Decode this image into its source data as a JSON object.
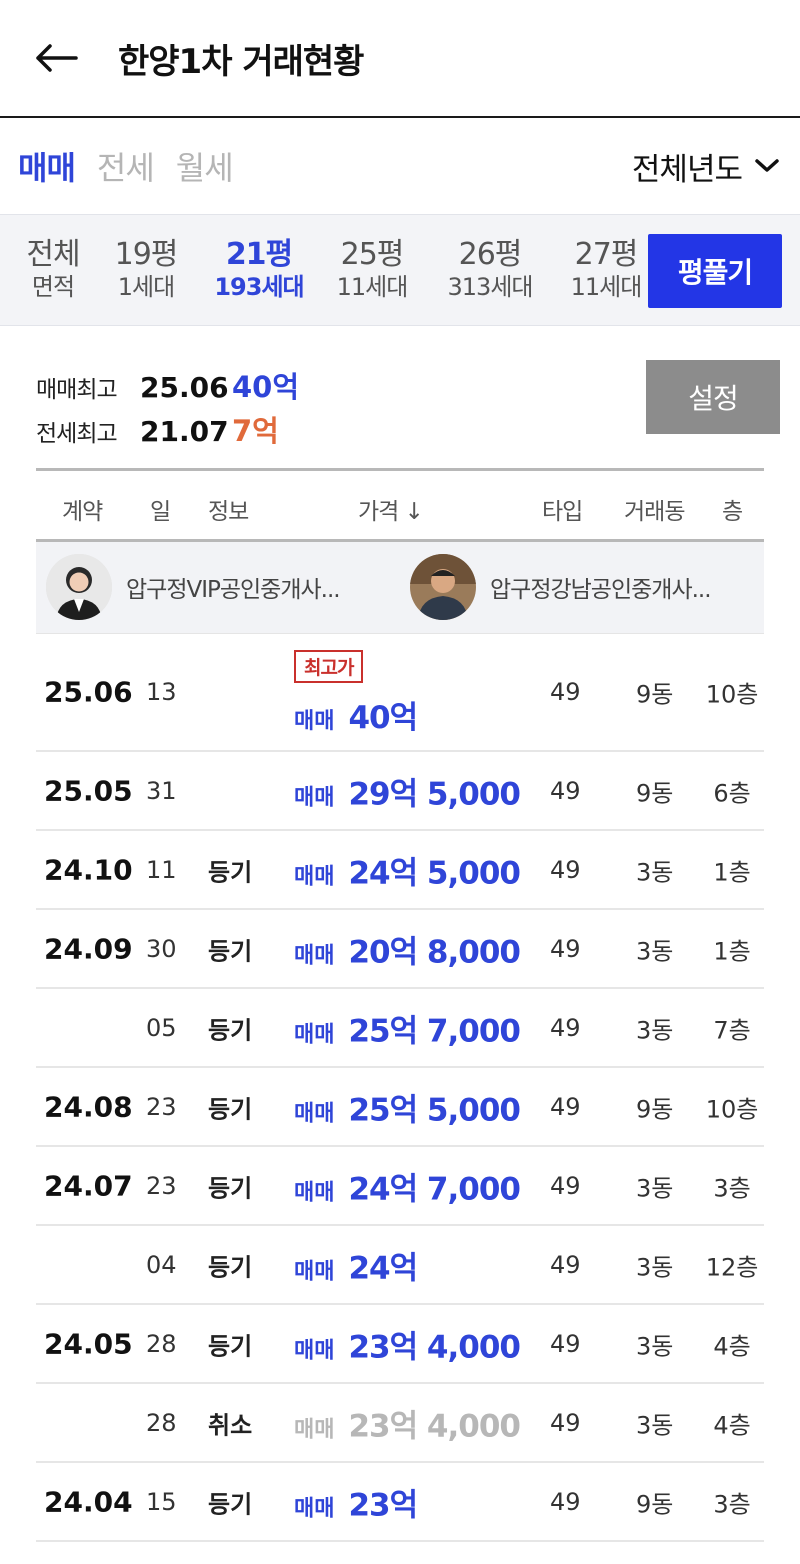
{
  "header": {
    "title": "한양1차 거래현황"
  },
  "deal_tabs": [
    {
      "label": "매매",
      "active": true
    },
    {
      "label": "전세",
      "active": false
    },
    {
      "label": "월세",
      "active": false
    }
  ],
  "year_select": {
    "label": "전체년도"
  },
  "area_tabs": [
    {
      "top": "전체",
      "bottom": "면적",
      "active": false
    },
    {
      "top": "19평",
      "bottom": "1세대",
      "active": false
    },
    {
      "top": "21평",
      "bottom": "193세대",
      "active": true
    },
    {
      "top": "25평",
      "bottom": "11세대",
      "active": false
    },
    {
      "top": "26평",
      "bottom": "313세대",
      "active": false
    },
    {
      "top": "27평",
      "bottom": "11세대",
      "active": false
    }
  ],
  "pyung_button": "평풀기",
  "summary": {
    "sale_label": "매매최고",
    "sale_date": "25.06",
    "sale_price": "40억",
    "jeonse_label": "전세최고",
    "jeonse_date": "21.07",
    "jeonse_price": "7억"
  },
  "settings_button": "설정",
  "table_headers": {
    "contract": "계약",
    "day": "일",
    "info": "정보",
    "price": "가격 ↓",
    "type": "타입",
    "dong": "거래동",
    "floor": "층"
  },
  "agents": [
    {
      "name": "압구정VIP공인중개사..."
    },
    {
      "name": "압구정강남공인중개사..."
    }
  ],
  "badge": "최고가",
  "rows": [
    {
      "month": "25.06",
      "day": "13",
      "info": "",
      "kind": "매매",
      "price": "40억",
      "type": "49",
      "dong": "9동",
      "floor": "10층"
    },
    {
      "month": "25.05",
      "day": "31",
      "info": "",
      "kind": "매매",
      "price": "29억 5,000",
      "type": "49",
      "dong": "9동",
      "floor": "6층"
    },
    {
      "month": "24.10",
      "day": "11",
      "info": "등기",
      "kind": "매매",
      "price": "24억 5,000",
      "type": "49",
      "dong": "3동",
      "floor": "1층"
    },
    {
      "month": "24.09",
      "day": "30",
      "info": "등기",
      "kind": "매매",
      "price": "20억 8,000",
      "type": "49",
      "dong": "3동",
      "floor": "1층"
    },
    {
      "month": "",
      "day": "05",
      "info": "등기",
      "kind": "매매",
      "price": "25억 7,000",
      "type": "49",
      "dong": "3동",
      "floor": "7층"
    },
    {
      "month": "24.08",
      "day": "23",
      "info": "등기",
      "kind": "매매",
      "price": "25억 5,000",
      "type": "49",
      "dong": "9동",
      "floor": "10층"
    },
    {
      "month": "24.07",
      "day": "23",
      "info": "등기",
      "kind": "매매",
      "price": "24억 7,000",
      "type": "49",
      "dong": "3동",
      "floor": "3층"
    },
    {
      "month": "",
      "day": "04",
      "info": "등기",
      "kind": "매매",
      "price": "24억",
      "type": "49",
      "dong": "3동",
      "floor": "12층"
    },
    {
      "month": "24.05",
      "day": "28",
      "info": "등기",
      "kind": "매매",
      "price": "23억 4,000",
      "type": "49",
      "dong": "3동",
      "floor": "4층"
    },
    {
      "month": "",
      "day": "28",
      "info": "취소",
      "kind": "매매",
      "price": "23억 4,000",
      "type": "49",
      "dong": "3동",
      "floor": "4층"
    },
    {
      "month": "24.04",
      "day": "15",
      "info": "등기",
      "kind": "매매",
      "price": "23억",
      "type": "49",
      "dong": "9동",
      "floor": "3층"
    }
  ]
}
